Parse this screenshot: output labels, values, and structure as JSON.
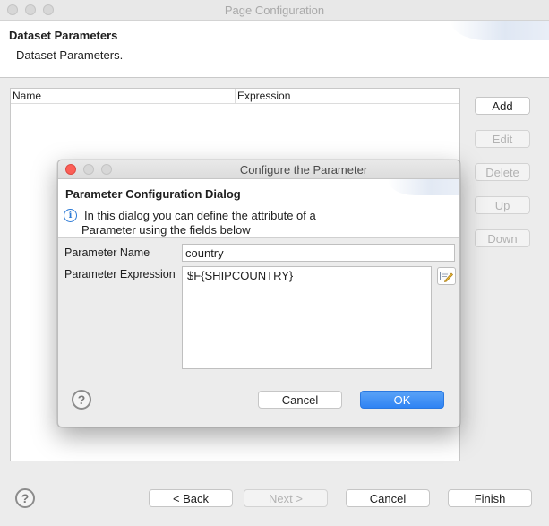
{
  "window": {
    "title": "Page Configuration"
  },
  "header": {
    "title": "Dataset Parameters",
    "description": "Dataset Parameters."
  },
  "table": {
    "columns": [
      "Name",
      "Expression"
    ],
    "rows": []
  },
  "side_buttons": {
    "add": "Add",
    "edit": "Edit",
    "delete": "Delete",
    "up": "Up",
    "down": "Down"
  },
  "footer": {
    "help_glyph": "?",
    "back": "< Back",
    "next": "Next >",
    "cancel": "Cancel",
    "finish": "Finish"
  },
  "dialog": {
    "title": "Configure the Parameter",
    "header_title": "Parameter Configuration Dialog",
    "info_glyph": "i",
    "message_line1": "In this dialog you can define the attribute of a",
    "message_line2": "Parameter using the fields below",
    "name_label": "Parameter Name",
    "name_value": "country",
    "expression_label": "Parameter Expression",
    "expression_value": "$F{SHIPCOUNTRY}",
    "help_glyph": "?",
    "cancel": "Cancel",
    "ok": "OK"
  }
}
